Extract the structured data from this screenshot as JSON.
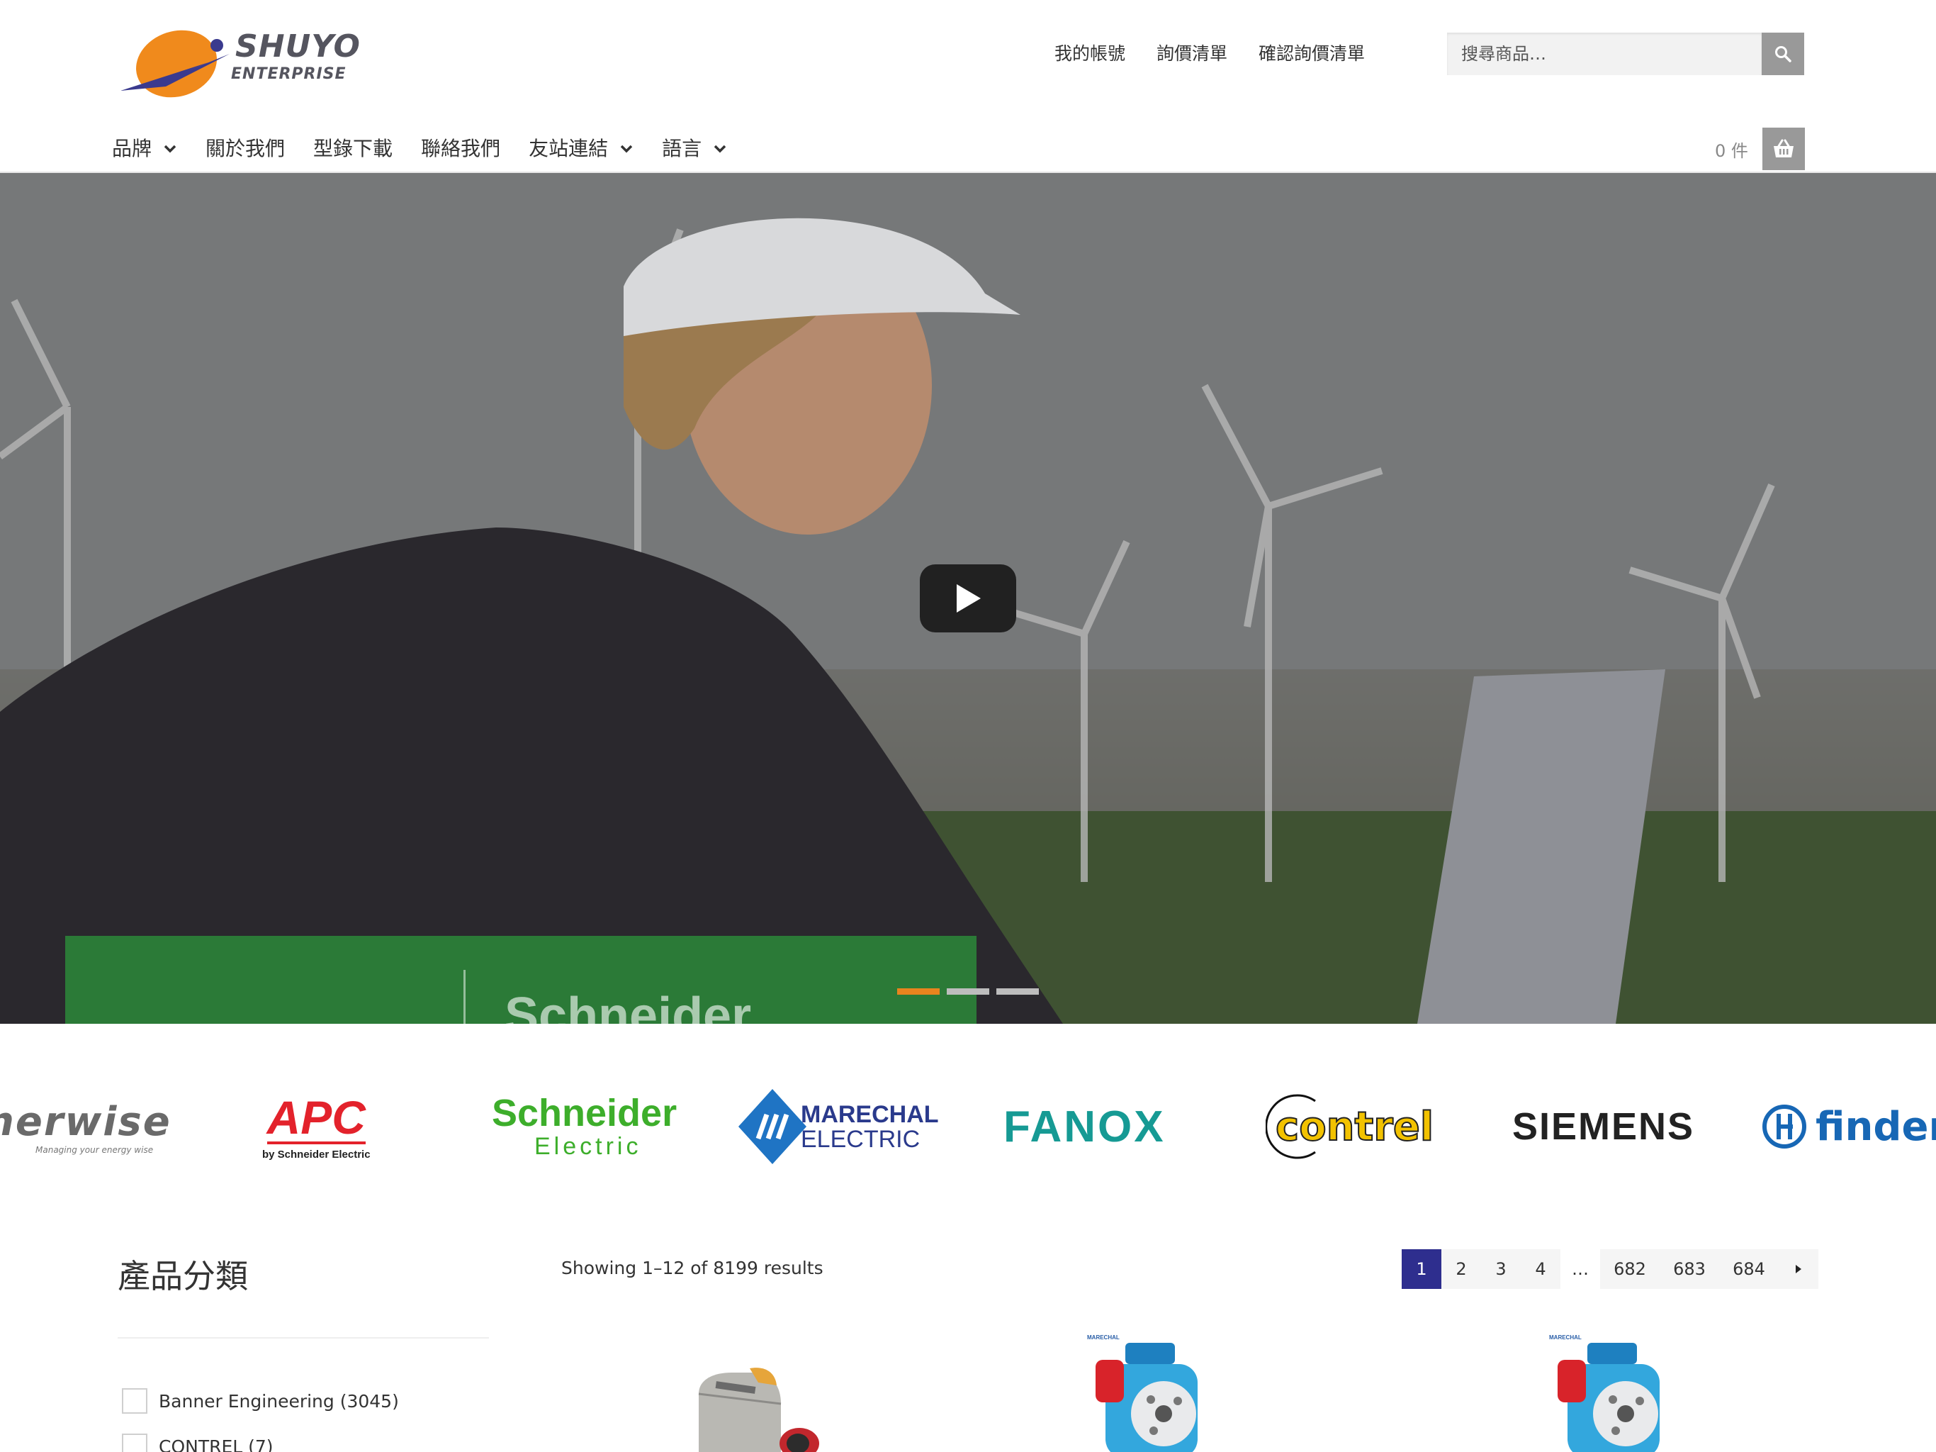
{
  "header": {
    "logo": {
      "name": "SHUYO",
      "sub": "ENTERPRISE"
    },
    "top_links": [
      "我的帳號",
      "詢價清單",
      "確認詢價清單"
    ],
    "search": {
      "placeholder": "搜尋商品…",
      "icon": "search-icon"
    },
    "nav": [
      {
        "label": "品牌",
        "has_dropdown": true
      },
      {
        "label": "關於我們",
        "has_dropdown": false
      },
      {
        "label": "型錄下載",
        "has_dropdown": false
      },
      {
        "label": "聯絡我們",
        "has_dropdown": false
      },
      {
        "label": "友站連結",
        "has_dropdown": true
      },
      {
        "label": "語言",
        "has_dropdown": true
      }
    ],
    "cart": {
      "count_label": "0 件",
      "icon": "basket-icon"
    }
  },
  "hero": {
    "play_icon": "play-icon",
    "slides": 3,
    "active_slide": 1,
    "banner_text": "Schneider"
  },
  "brands": [
    {
      "name": "nerwise",
      "tagline": "Managing your energy wise"
    },
    {
      "name": "APC",
      "tagline": "by Schneider Electric"
    },
    {
      "name": "Schneider",
      "tagline": "Electric"
    },
    {
      "name": "MARECHAL",
      "tagline": "ELECTRIC"
    },
    {
      "name": "FANOX",
      "tagline": ""
    },
    {
      "name": "contrel",
      "tagline": ""
    },
    {
      "name": "SIEMENS",
      "tagline": ""
    },
    {
      "name": "finder",
      "tagline": ""
    }
  ],
  "sidebar": {
    "title": "產品分類",
    "filters": [
      {
        "label": "Banner Engineering (3045)"
      },
      {
        "label": "CONTREL (7)"
      }
    ]
  },
  "results": {
    "count_text": "Showing 1–12 of 8199 results",
    "pages": [
      "1",
      "2",
      "3",
      "4",
      "…",
      "682",
      "683",
      "684"
    ],
    "current_page": "1",
    "next_icon": "caret-right-icon"
  },
  "products": [
    {
      "brand_label": "",
      "image": "sensor"
    },
    {
      "brand_label": "MARECHAL",
      "image": "connector"
    },
    {
      "brand_label": "MARECHAL",
      "image": "connector"
    }
  ]
}
